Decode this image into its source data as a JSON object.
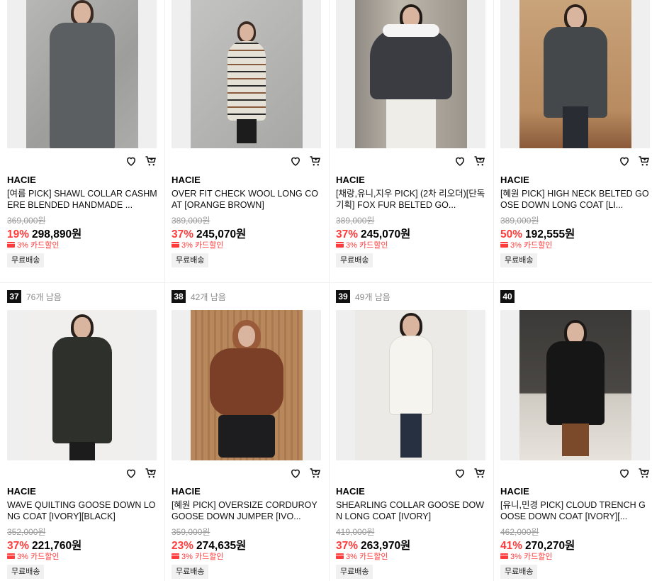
{
  "colors": {
    "discount": "#ff3b3b",
    "rank_badge": "#111111"
  },
  "ui": {
    "wishlist_icon": "heart-icon",
    "cart_icon": "cart-icon",
    "card_icon": "credit-card-icon"
  },
  "row1": [
    {
      "brand": "HACIE",
      "name": "[여름 PICK] SHAWL COLLAR CASHMERE BLENDED HANDMADE ...",
      "original_price": "369,000원",
      "discount": "19%",
      "price": "298,890원",
      "card_discount": "3% 카드할인",
      "shipping": "무료배송"
    },
    {
      "brand": "HACIE",
      "name": "OVER FIT CHECK WOOL LONG COAT [ORANGE BROWN]",
      "original_price": "389,000원",
      "discount": "37%",
      "price": "245,070원",
      "card_discount": "3% 카드할인",
      "shipping": "무료배송"
    },
    {
      "brand": "HACIE",
      "name": "[채랑,유니,지우 PICK] (2차 리오더)[단독기획] FOX FUR BELTED GO...",
      "original_price": "389,000원",
      "discount": "37%",
      "price": "245,070원",
      "card_discount": "3% 카드할인",
      "shipping": "무료배송"
    },
    {
      "brand": "HACIE",
      "name": "[혜원 PICK] HIGH NECK BELTED GOOSE DOWN LONG COAT [LI...",
      "original_price": "389,000원",
      "discount": "50%",
      "price": "192,555원",
      "card_discount": "3% 카드할인",
      "shipping": "무료배송"
    }
  ],
  "row2": [
    {
      "rank": "37",
      "remaining": "76개 남음",
      "brand": "HACIE",
      "name": "WAVE QUILTING GOOSE DOWN LONG COAT [IVORY][BLACK]",
      "original_price": "352,000원",
      "discount": "37%",
      "price": "221,760원",
      "card_discount": "3% 카드할인",
      "shipping": "무료배송"
    },
    {
      "rank": "38",
      "remaining": "42개 남음",
      "brand": "HACIE",
      "name": "[혜원 PICK] OVERSIZE CORDUROY GOOSE DOWN JUMPER [IVO...",
      "original_price": "359,000원",
      "discount": "23%",
      "price": "274,635원",
      "card_discount": "3% 카드할인",
      "shipping": "무료배송"
    },
    {
      "rank": "39",
      "remaining": "49개 남음",
      "brand": "HACIE",
      "name": "SHEARLING COLLAR GOOSE DOWN LONG COAT [IVORY]",
      "original_price": "419,000원",
      "discount": "37%",
      "price": "263,970원",
      "card_discount": "3% 카드할인",
      "shipping": "무료배송"
    },
    {
      "rank": "40",
      "remaining": "",
      "brand": "HACIE",
      "name": "[유니,민경 PICK] CLOUD TRENCH GOOSE DOWN COAT [IVORY][...",
      "original_price": "462,000원",
      "discount": "41%",
      "price": "270,270원",
      "card_discount": "3% 카드할인",
      "shipping": "무료배송"
    }
  ]
}
